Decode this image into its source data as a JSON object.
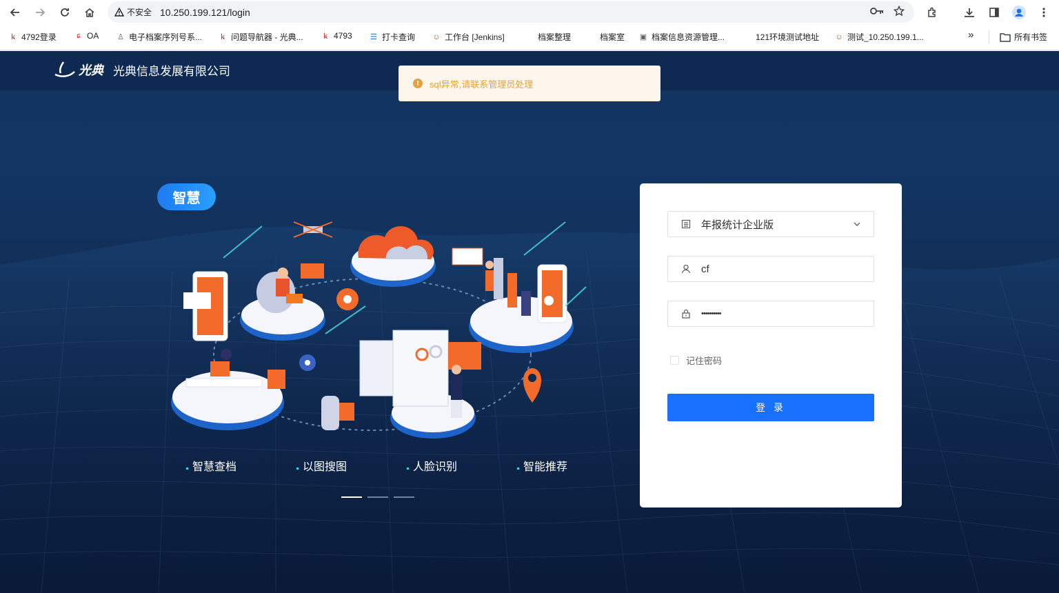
{
  "browser": {
    "security_label": "不安全",
    "url": "10.250.199.121/login",
    "bookmarks": [
      {
        "label": "4792登录",
        "icon": "red-brand-icon"
      },
      {
        "label": "OA",
        "icon": "red-brand-icon"
      },
      {
        "label": "电子档案序列号系...",
        "icon": "person-icon"
      },
      {
        "label": "问题导航器 - 光典...",
        "icon": "red-brand-icon"
      },
      {
        "label": "4793",
        "icon": "red-brand-icon"
      },
      {
        "label": "打卡查询",
        "icon": "list-icon"
      },
      {
        "label": "工作台 [Jenkins]",
        "icon": "jenkins-icon"
      },
      {
        "label": "档案整理",
        "icon": ""
      },
      {
        "label": "档案室",
        "icon": ""
      },
      {
        "label": "档案信息资源管理...",
        "icon": "image-icon"
      },
      {
        "label": "121环境测试地址",
        "icon": ""
      },
      {
        "label": "测试_10.250.199.1...",
        "icon": "jenkins-icon"
      }
    ],
    "more_bookmarks": "»",
    "all_bookmarks_label": "所有书签"
  },
  "header": {
    "brand": "光典",
    "company": "光典信息发展有限公司"
  },
  "toast": {
    "message": "sql异常,请联系管理员处理",
    "type": "warning"
  },
  "hero": {
    "badge": "智慧",
    "features": [
      "智慧查档",
      "以图搜图",
      "人脸识别",
      "智能推荐"
    ],
    "carousel": {
      "slides": 3,
      "active": 0
    }
  },
  "login": {
    "system_select": "年报统计企业版",
    "username": "cf",
    "password_masked": "••••••••••",
    "remember_label": "记住密码",
    "remember_checked": false,
    "submit_label": "登 录"
  },
  "colors": {
    "primary": "#1870fc",
    "warning": "#e6a23c",
    "page_bg": "#12325c",
    "accent_orange": "#f0641e"
  }
}
